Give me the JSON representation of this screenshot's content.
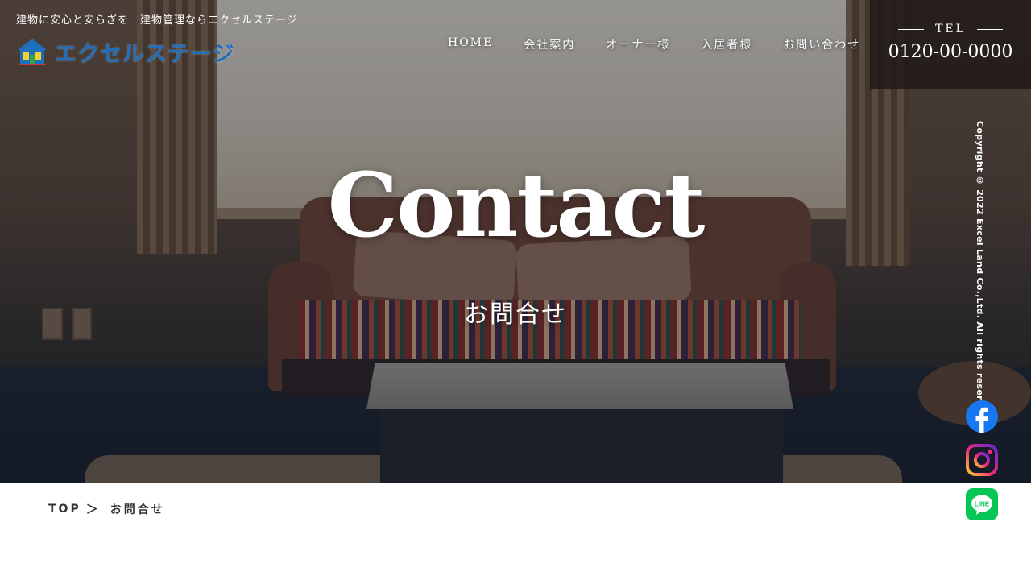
{
  "header": {
    "tagline": "建物に安心と安らぎを　建物管理ならエクセルステージ",
    "logo_text": "エクセルステージ",
    "logo_icon": "house-logo-icon"
  },
  "nav": {
    "items": [
      {
        "label": "HOME"
      },
      {
        "label": "会社案内"
      },
      {
        "label": "オーナー様"
      },
      {
        "label": "入居者様"
      },
      {
        "label": "お問い合わせ"
      }
    ]
  },
  "tel": {
    "label": "TEL",
    "number": "0120-00-0000"
  },
  "hero": {
    "title": "Contact",
    "subtitle": "お問合せ"
  },
  "side": {
    "copyright": "Copyright © 2022 Excel Land Co.,Ltd. All rights reserved.",
    "social": [
      {
        "name": "facebook-icon",
        "color": "#1877F2"
      },
      {
        "name": "instagram-icon",
        "color": "#E1306C"
      },
      {
        "name": "line-icon",
        "color": "#06C755"
      }
    ]
  },
  "breadcrumb": {
    "top_label": "TOP",
    "separator": "＞",
    "current_label": "お問合せ"
  },
  "colors": {
    "logo_blue": "#1f6fbf",
    "tel_bg": "#1e1816",
    "text_dark": "#333333"
  }
}
